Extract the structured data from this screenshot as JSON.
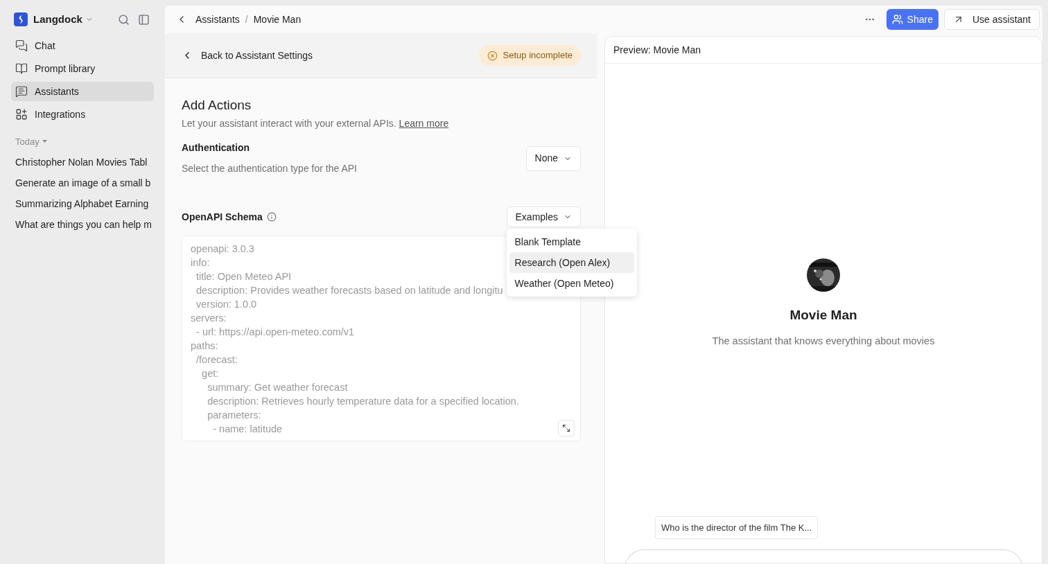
{
  "sidebar": {
    "workspace": "Langdock",
    "nav": [
      {
        "label": "Chat",
        "kind": "chat",
        "selected": false
      },
      {
        "label": "Prompt library",
        "kind": "library",
        "selected": false
      },
      {
        "label": "Assistants",
        "kind": "assistants",
        "selected": true
      },
      {
        "label": "Integrations",
        "kind": "integrations",
        "selected": false
      }
    ],
    "section": "Today",
    "history": [
      "Christopher Nolan Movies Tabl",
      "Generate an image of a small b",
      "Summarizing Alphabet Earning",
      "What are things you can help m"
    ]
  },
  "breadcrumb": {
    "parent": "Assistants",
    "separator": "/",
    "current": "Movie Man"
  },
  "actions": {
    "share": "Share",
    "use": "Use assistant"
  },
  "settings": {
    "back": "Back to Assistant Settings",
    "status": "Setup incomplete",
    "title": "Add Actions",
    "subtitle": "Let your assistant interact with your external APIs.",
    "link": "Learn more",
    "auth": {
      "label": "Authentication",
      "hint": "Select the authentication type for the API",
      "value": "None"
    },
    "schema": {
      "label": "OpenAPI Schema",
      "examples": "Examples",
      "menu": [
        {
          "label": "Blank Template",
          "selected": false
        },
        {
          "label": "Research (Open Alex)",
          "selected": true
        },
        {
          "label": "Weather (Open Meteo)",
          "selected": false
        }
      ],
      "code": [
        "openapi: 3.0.3",
        "info:",
        "  title: Open Meteo API",
        "  description: Provides weather forecasts based on latitude and longitu",
        "  version: 1.0.0",
        "servers:",
        "  - url: https://api.open-meteo.com/v1",
        "paths:",
        "  /forecast:",
        "    get:",
        "      summary: Get weather forecast",
        "      description: Retrieves hourly temperature data for a specified location.",
        "      parameters:",
        "        - name: latitude"
      ]
    }
  },
  "preview": {
    "title": "Preview: Movie Man",
    "name": "Movie Man",
    "description": "The assistant that knows everything about movies",
    "suggestion": "Who is the director of the film The K..."
  }
}
